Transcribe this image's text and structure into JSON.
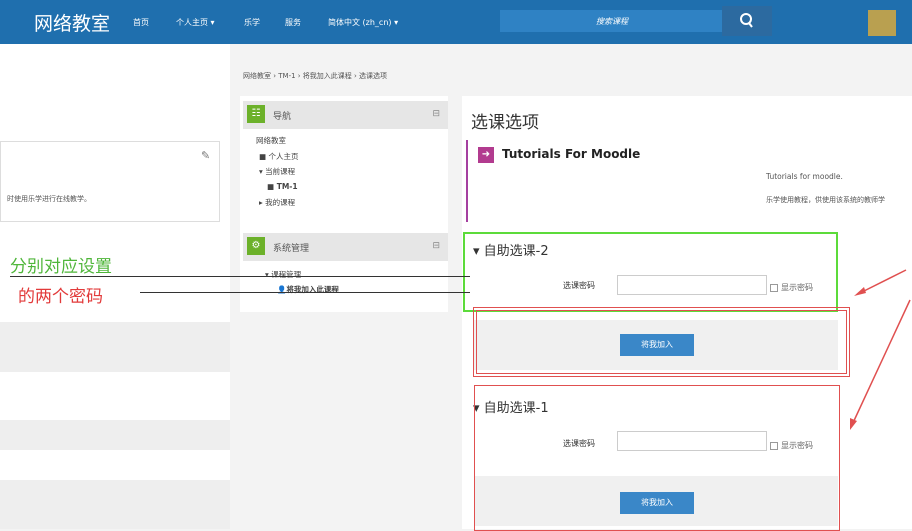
{
  "topbar": {
    "brand": "网络教室",
    "nav": [
      "首页",
      "个人主页 ▾",
      "乐学",
      "服务",
      "简体中文 (zh_cn) ▾"
    ],
    "search_placeholder": "搜索课程",
    "search_icon": "search-icon"
  },
  "left": {
    "edit_icon": "edit-icon",
    "partial_text": "时使用乐学进行在线教学。"
  },
  "annotation": {
    "line1": "分别对应设置",
    "line2": "的两个密码"
  },
  "breadcrumb": "网络教室 › TM-1 › 将我加入此课程 › 选课选项",
  "navblock": {
    "title": "导航",
    "toggle": "⊟",
    "items": [
      "网络教室",
      "■ 个人主页",
      "▾ 当前课程",
      "■ TM-1",
      "▸ 我的课程"
    ]
  },
  "adminblock": {
    "title": "系统管理",
    "toggle": "⊟",
    "items": [
      "▾ 课程管理",
      "将我加入此课程"
    ]
  },
  "page_title": "选课选项",
  "course": {
    "title": "Tutorials For Moodle",
    "desc1": "Tutorials for moodle.",
    "desc2": "乐学使用教程，供使用该系统的教师学"
  },
  "section2": {
    "header": "▾ 自助选课-2",
    "pw_label": "选课密码",
    "show_pw": "显示密码",
    "enroll": "将我加入"
  },
  "section1": {
    "header": "▾ 自助选课-1",
    "pw_label": "选课密码",
    "show_pw": "显示密码",
    "enroll": "将我加入"
  },
  "colors": {
    "primary": "#1f6fae",
    "green": "#5cdb3a",
    "red": "#e05050",
    "button": "#3a87c8"
  }
}
